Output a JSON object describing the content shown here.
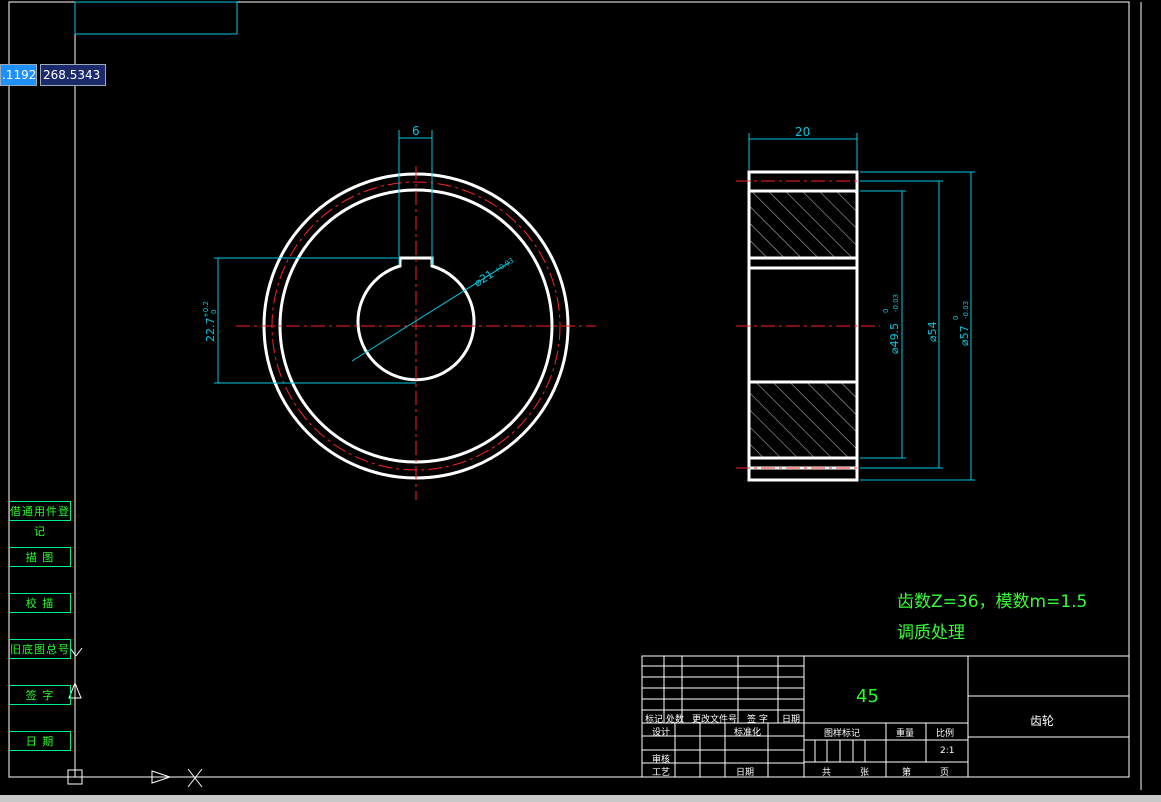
{
  "coords": {
    "x": ".1192",
    "y": "268.5343"
  },
  "dims": {
    "keyway_width": "6",
    "hole_diameter": "⌀21",
    "hole_tol": "+0.03",
    "key_depth": "22.7",
    "key_tol_up": "+0.2",
    "key_tol_low": "0",
    "face_width": "20",
    "d_root": "⌀49.5",
    "d_root_tol": "-0.03",
    "d_pitch": "⌀54",
    "d_tip": "⌀57",
    "d_tip_tol": "-0.03",
    "tol_zero": "0"
  },
  "notes": {
    "line1": "齿数Z=36，模数m=1.5",
    "line2": "调质处理"
  },
  "side_panel": {
    "items": [
      "借通用件登记",
      "描  图",
      "校  描",
      "旧底图总号",
      "签  字",
      "日  期"
    ]
  },
  "title_block": {
    "material": "45",
    "part_name": "齿轮",
    "scale": "2:1",
    "rev_headers": [
      "标记",
      "处数",
      "更改文件号",
      "签 字",
      "日期"
    ],
    "design_label": "设计",
    "std_label": "标准化",
    "check_label": "审核",
    "process_label": "工艺",
    "date_label": "日期",
    "stage_label": "图样标记",
    "weight_label": "重量",
    "scale_label": "比例",
    "total_label": "共",
    "sheet_label": "张",
    "page_label": "第",
    "page_suffix": "页"
  },
  "colors": {
    "background": "#000000",
    "outline": "#ffffff",
    "dimension": "#00c8e0",
    "centerline": "#ff2020",
    "note": "#33ff33"
  }
}
